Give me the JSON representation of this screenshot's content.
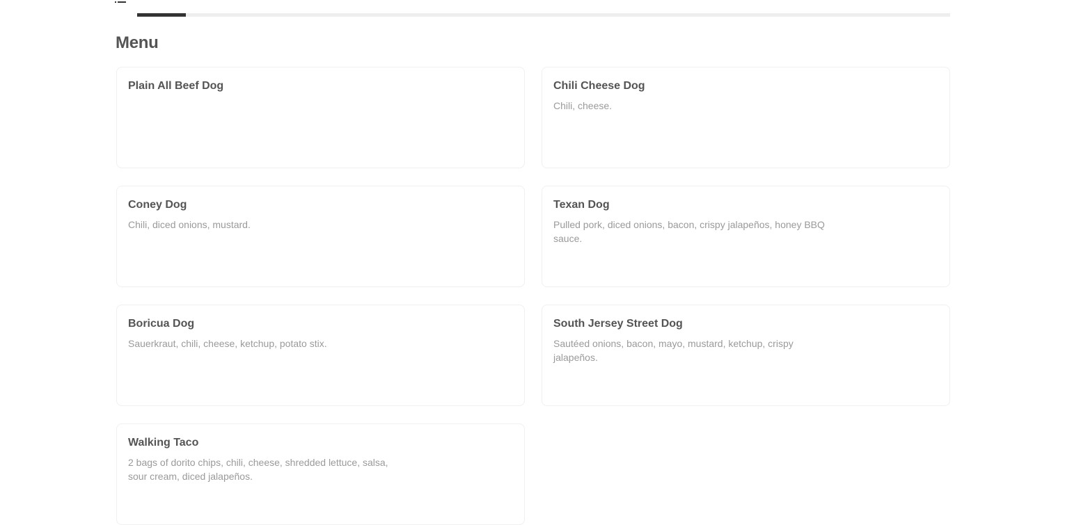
{
  "header": {
    "icon": "list-icon",
    "progress_fraction": 0.06
  },
  "menu": {
    "title": "Menu",
    "items": [
      {
        "name": "Plain All Beef Dog",
        "description": ""
      },
      {
        "name": "Chili Cheese Dog",
        "description": "Chili, cheese."
      },
      {
        "name": "Coney Dog",
        "description": "Chili, diced onions, mustard."
      },
      {
        "name": "Texan Dog",
        "description": "Pulled pork, diced onions, bacon, crispy jalapeños, honey BBQ sauce."
      },
      {
        "name": "Boricua Dog",
        "description": "Sauerkraut, chili, cheese, ketchup, potato stix."
      },
      {
        "name": "South Jersey Street Dog",
        "description": "Sautéed onions, bacon, mayo, mustard, ketchup, crispy jalapeños."
      },
      {
        "name": "Walking Taco",
        "description": "2 bags of dorito chips, chili, cheese, shredded lettuce, salsa, sour cream, diced jalapeños."
      }
    ]
  },
  "colors": {
    "accent": "#333333",
    "card_border": "#f0f0f0",
    "muted_text": "#9a9a9a"
  }
}
